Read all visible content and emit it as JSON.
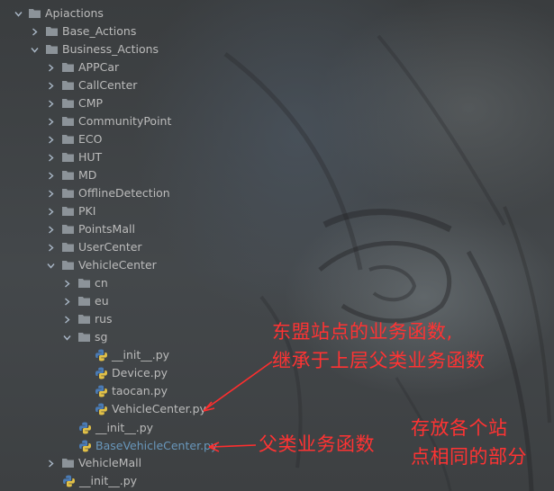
{
  "tree": {
    "apiactions": "Apiactions",
    "base_actions": "Base_Actions",
    "business_actions": "Business_Actions",
    "appcar": "APPCar",
    "callcenter": "CallCenter",
    "cmp": "CMP",
    "communitypoint": "CommunityPoint",
    "eco": "ECO",
    "hut": "HUT",
    "md": "MD",
    "offlinedetection": "OfflineDetection",
    "pki": "PKI",
    "pointsmall": "PointsMall",
    "usercenter": "UserCenter",
    "vehiclecenter": "VehicleCenter",
    "cn": "cn",
    "eu": "eu",
    "rus": "rus",
    "sg": "sg",
    "sg_init": "__init__.py",
    "sg_device": "Device.py",
    "sg_taocan": "taocan.py",
    "sg_vehiclecenter": "VehicleCenter.py",
    "vc_init": "__init__.py",
    "basevehiclecenter": "BaseVehicleCenter.py",
    "vehiclemall": "VehicleMall",
    "root_init": "__init__.py"
  },
  "annotations": {
    "sg_note_line1": "东盟站点的业务函数,",
    "sg_note_line2": "继承于上层父类业务函数",
    "parent_note": "父类业务函数",
    "common_note_line1": "存放各个站",
    "common_note_line2": "点相同的部分"
  },
  "colors": {
    "folder": "#8c9399",
    "text": "#bbbbbb",
    "selected_file": "#6897bb",
    "annotation": "#ff3333"
  }
}
